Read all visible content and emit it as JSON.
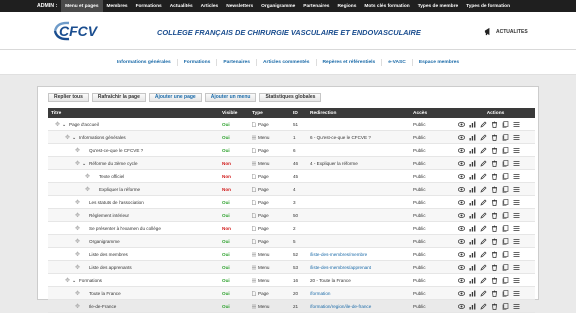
{
  "admin_bar": {
    "label": "ADMIN :",
    "items": [
      {
        "label": "Menu et pages",
        "active": true
      },
      {
        "label": "Membres"
      },
      {
        "label": "Formations"
      },
      {
        "label": "Actualités"
      },
      {
        "label": "Articles"
      },
      {
        "label": "Newsletters"
      },
      {
        "label": "Organigramme"
      },
      {
        "label": "Partenaires"
      },
      {
        "label": "Regions"
      },
      {
        "label": "Mots clés formation"
      },
      {
        "label": "Types de membre"
      },
      {
        "label": "Types de formation"
      }
    ]
  },
  "header": {
    "logo_text": "CFCV",
    "title": "COLLEGE FRANÇAIS DE CHIRURGIE VASCULAIRE ET ENDOVASCULAIRE",
    "actualites_label": "ACTUALITES"
  },
  "nav": {
    "items": [
      "Informations générales",
      "Formations",
      "Partenaires",
      "Articles commentés",
      "Repères et référentiels",
      "e-VASC",
      "Espace membres"
    ]
  },
  "toolbar": {
    "refresh_all": "Replier tous",
    "refresh_page": "Rafraîchir la page",
    "add_page": "Ajouter une page",
    "add_menu": "Ajouter un menu",
    "stats": "Statistiques globales"
  },
  "table": {
    "headers": {
      "title": "Titre",
      "visible": "Visible",
      "type": "Type",
      "id": "ID",
      "redirect": "Redirection",
      "access": "Accès",
      "actions": "Actions"
    },
    "rows": [
      {
        "depth": 0,
        "toggle": true,
        "title": "Page d'accueil",
        "visible": "Oui",
        "type": "Page",
        "type_icon": "page",
        "id": "51",
        "redirect": "",
        "access": "Public"
      },
      {
        "depth": 1,
        "toggle": true,
        "title": "Informations générales",
        "visible": "Oui",
        "type": "Menu",
        "type_icon": "menu",
        "id": "1",
        "redirect": "6 - Qu'est-ce-que le CFCVE ?",
        "access": "Public"
      },
      {
        "depth": 2,
        "toggle": false,
        "title": "Qu'est-ce-que le CFCVE ?",
        "visible": "Oui",
        "type": "Page",
        "type_icon": "page",
        "id": "6",
        "redirect": "",
        "access": "Public"
      },
      {
        "depth": 2,
        "toggle": true,
        "title": "Réforme du 3ème cycle",
        "visible": "Non",
        "type": "Menu",
        "type_icon": "menu",
        "id": "46",
        "redirect": "4 - Expliquer la réforme",
        "access": "Public"
      },
      {
        "depth": 3,
        "toggle": false,
        "title": "Texte officiel",
        "visible": "Non",
        "type": "Page",
        "type_icon": "page",
        "id": "45",
        "redirect": "",
        "access": "Public"
      },
      {
        "depth": 3,
        "toggle": false,
        "title": "Expliquer la réforme",
        "visible": "Non",
        "type": "Page",
        "type_icon": "page",
        "id": "4",
        "redirect": "",
        "access": "Public"
      },
      {
        "depth": 2,
        "toggle": false,
        "title": "Les statuts de l'association",
        "visible": "Oui",
        "type": "Page",
        "type_icon": "page",
        "id": "3",
        "redirect": "",
        "access": "Public"
      },
      {
        "depth": 2,
        "toggle": false,
        "title": "Règlement intérieur",
        "visible": "Oui",
        "type": "Page",
        "type_icon": "page",
        "id": "50",
        "redirect": "",
        "access": "Public"
      },
      {
        "depth": 2,
        "toggle": false,
        "title": "Se présenter à l'examen du collège",
        "visible": "Non",
        "type": "Page",
        "type_icon": "page",
        "id": "2",
        "redirect": "",
        "access": "Public"
      },
      {
        "depth": 2,
        "toggle": false,
        "title": "Organigramme",
        "visible": "Oui",
        "type": "Page",
        "type_icon": "page",
        "id": "5",
        "redirect": "",
        "access": "Public"
      },
      {
        "depth": 2,
        "toggle": false,
        "title": "Liste des membres",
        "visible": "Oui",
        "type": "Menu",
        "type_icon": "menu",
        "id": "52",
        "redirect": "/liste-des-membres/membre",
        "access": "Public"
      },
      {
        "depth": 2,
        "toggle": false,
        "title": "Liste des apprenants",
        "visible": "Oui",
        "type": "Menu",
        "type_icon": "menu",
        "id": "53",
        "redirect": "/liste-des-membres/apprenant",
        "access": "Public"
      },
      {
        "depth": 1,
        "toggle": true,
        "title": "Formations",
        "visible": "Oui",
        "type": "Menu",
        "type_icon": "menu",
        "id": "16",
        "redirect": "20 - Toute la France",
        "access": "Public"
      },
      {
        "depth": 2,
        "toggle": false,
        "title": "Toute la France",
        "visible": "Oui",
        "type": "Page",
        "type_icon": "page",
        "id": "20",
        "redirect": "/formation",
        "access": "Public"
      },
      {
        "depth": 2,
        "toggle": false,
        "title": "Ile-de-France",
        "visible": "Oui",
        "type": "Menu",
        "type_icon": "menu",
        "id": "21",
        "redirect": "/formation/region/ile-de-france",
        "access": "Public"
      }
    ]
  },
  "colors": {
    "admin_bar": "#1f1f1f",
    "title_blue": "#1a4d8f",
    "link_blue": "#1a6aa8",
    "yes_green": "#2aa02a",
    "no_red": "#d01818",
    "table_header": "#3a3a3a"
  }
}
